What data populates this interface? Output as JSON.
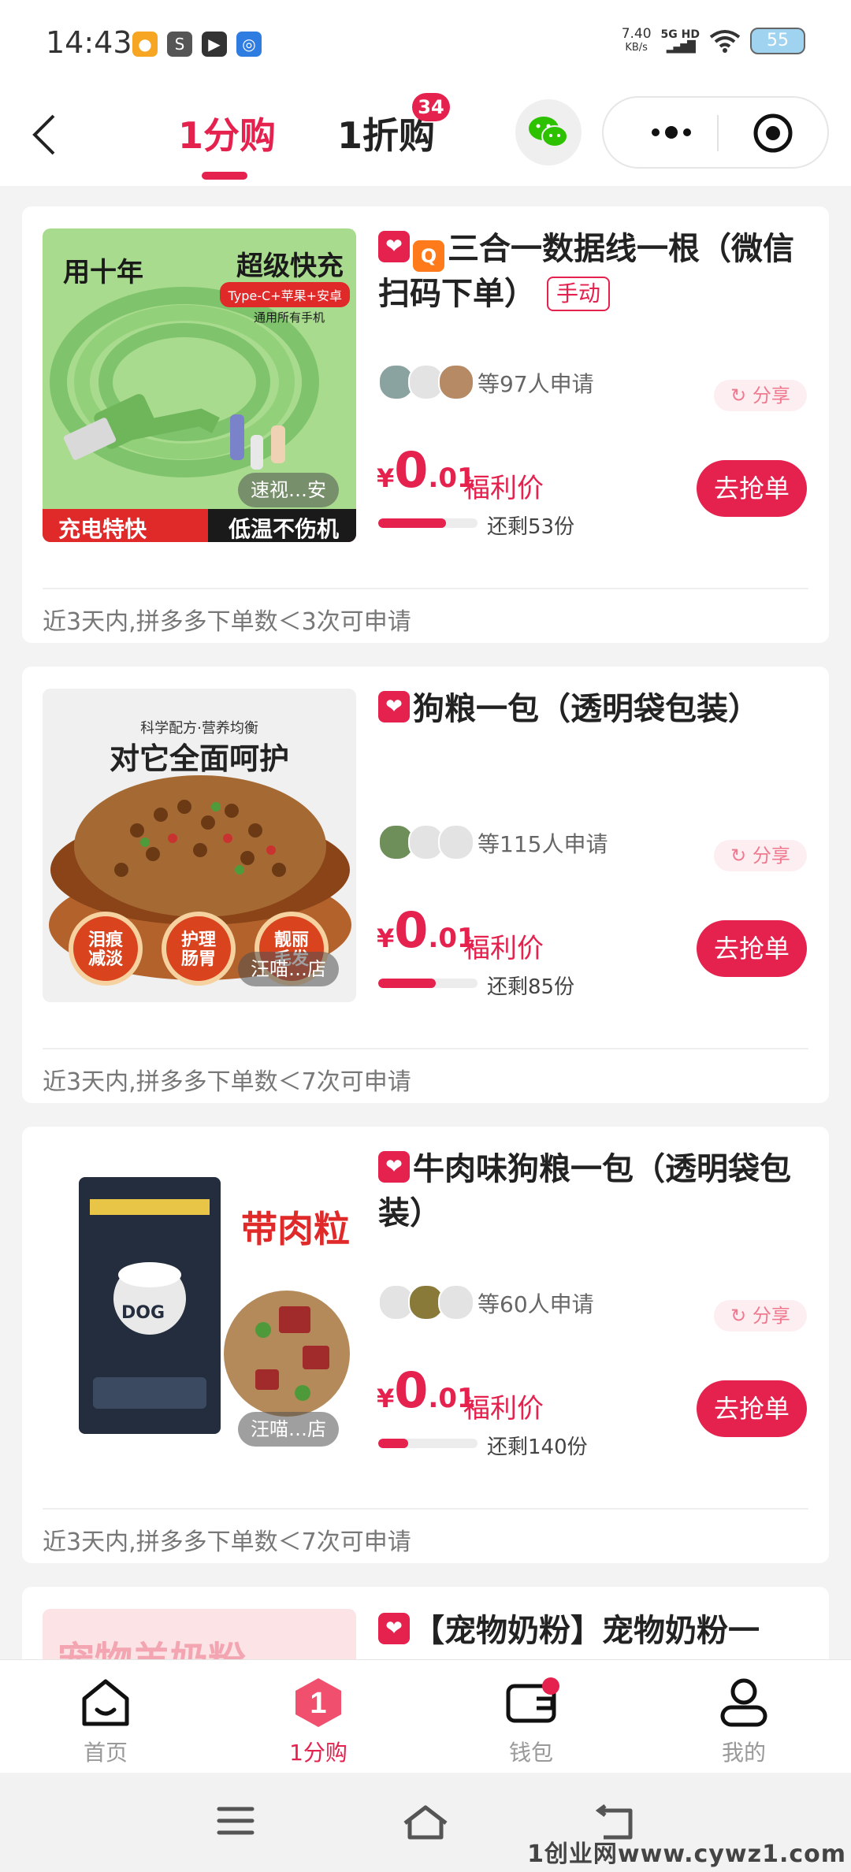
{
  "status_bar": {
    "time": "14:43",
    "net_speed_value": "7.40",
    "net_speed_unit": "KB/s",
    "signal_label": "5G HD",
    "battery": "55"
  },
  "header": {
    "tab_1": "1分购",
    "tab_2": "1折购",
    "tab_2_badge": "34"
  },
  "products": [
    {
      "title": "三合一数据线一根（微信扫码下单）",
      "tag": "手动",
      "applicants": "等97人申请",
      "share": "分享",
      "price_symbol": "¥",
      "price_int": "0",
      "price_dec": ".01",
      "price_label": "福利价",
      "button": "去抢单",
      "remaining": "还剩53份",
      "progress": 0.68,
      "rule": "近3天内,拼多多下单数＜3次可申请",
      "image": {
        "top_left": "用十年",
        "top_right": "超级快充",
        "badge": "Type-C+苹果+安卓",
        "sub": "通用所有手机",
        "bottom_left": "充电特快",
        "bottom_right": "低温不伤机",
        "shop": "速视…安"
      }
    },
    {
      "title": "狗粮一包（透明袋包装）",
      "applicants": "等115人申请",
      "share": "分享",
      "price_symbol": "¥",
      "price_int": "0",
      "price_dec": ".01",
      "price_label": "福利价",
      "button": "去抢单",
      "remaining": "还剩85份",
      "progress": 0.58,
      "rule": "近3天内,拼多多下单数＜7次可申请",
      "image": {
        "subhead": "科学配方·营养均衡",
        "headline": "对它全面呵护",
        "circle_1": "泪痕减淡",
        "circle_2": "护理肠胃",
        "circle_3": "靓丽毛发",
        "shop": "汪喵…店"
      }
    },
    {
      "title": "牛肉味狗粮一包（透明袋包装）",
      "applicants": "等60人申请",
      "share": "分享",
      "price_symbol": "¥",
      "price_int": "0",
      "price_dec": ".01",
      "price_label": "福利价",
      "button": "去抢单",
      "remaining": "还剩140份",
      "progress": 0.3,
      "rule": "近3天内,拼多多下单数＜7次可申请",
      "image": {
        "headline": "带肉粒",
        "bag_text": "DOG",
        "shop": "汪喵…店"
      }
    },
    {
      "title": "【宠物奶粉】宠物奶粉一",
      "image": {
        "headline": "宠物羊奶粉"
      }
    }
  ],
  "bottom_nav": [
    {
      "label": "首页",
      "icon": "home-icon"
    },
    {
      "label": "1分购",
      "icon": "one-badge-icon"
    },
    {
      "label": "钱包",
      "icon": "wallet-icon"
    },
    {
      "label": "我的",
      "icon": "user-icon"
    }
  ],
  "watermark": "1创业网www.cywz1.com",
  "colors": {
    "accent": "#e5214e",
    "background": "#f3f3f3"
  }
}
